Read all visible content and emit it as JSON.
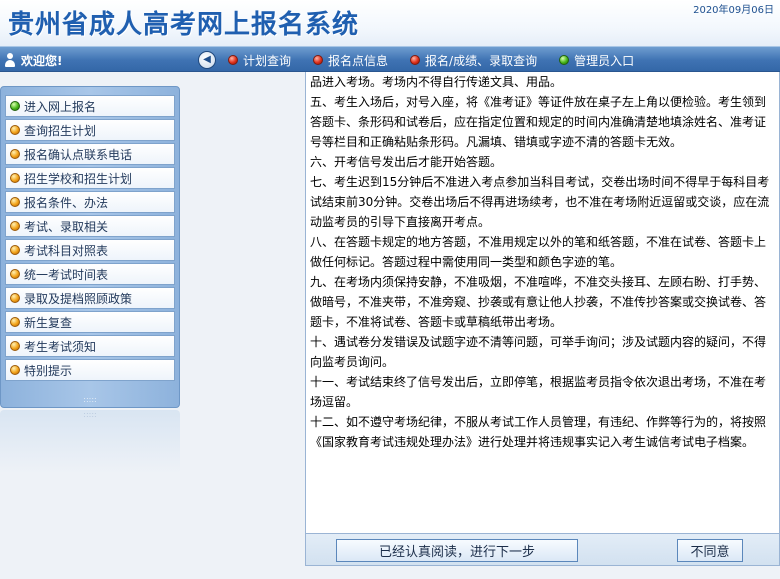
{
  "header": {
    "title": "贵州省成人高考网上报名系统",
    "date": "2020年09月06日"
  },
  "navbar": {
    "welcome": "欢迎您!",
    "items": [
      {
        "label": "计划查询"
      },
      {
        "label": "报名点信息"
      },
      {
        "label": "报名/成绩、录取查询"
      },
      {
        "label": "管理员入口"
      }
    ]
  },
  "sidebar": {
    "items": [
      {
        "label": "进入网上报名"
      },
      {
        "label": "查询招生计划"
      },
      {
        "label": "报名确认点联系电话"
      },
      {
        "label": "招生学校和招生计划"
      },
      {
        "label": "报名条件、办法"
      },
      {
        "label": "考试、录取相关"
      },
      {
        "label": "考试科目对照表"
      },
      {
        "label": "统一考试时间表"
      },
      {
        "label": "录取及提档照顾政策"
      },
      {
        "label": "新生复查"
      },
      {
        "label": "考生考试须知"
      },
      {
        "label": "特别提示"
      }
    ]
  },
  "content": {
    "paragraphs": [
      "品进入考场。考场内不得自行传递文具、用品。",
      "五、考生入场后，对号入座，将《准考证》等证件放在桌子左上角以便检验。考生领到答题卡、条形码和试卷后，应在指定位置和规定的时间内准确清楚地填涂姓名、准考证号等栏目和正确粘贴条形码。凡漏填、错填或字迹不清的答题卡无效。",
      "六、开考信号发出后才能开始答题。",
      "七、考生迟到15分钟后不准进入考点参加当科目考试，交卷出场时间不得早于每科目考试结束前30分钟。交卷出场后不得再进场续考，也不准在考场附近逗留或交谈，应在流动监考员的引导下直接离开考点。",
      "八、在答题卡规定的地方答题，不准用规定以外的笔和纸答题，不准在试卷、答题卡上做任何标记。答题过程中需使用同一类型和颜色字迹的笔。",
      "九、在考场内须保持安静，不准吸烟，不准喧哗，不准交头接耳、左顾右盼、打手势、做暗号，不准夹带，不准旁窥、抄袭或有意让他人抄袭，不准传抄答案或交换试卷、答题卡，不准将试卷、答题卡或草稿纸带出考场。",
      "十、遇试卷分发错误及试题字迹不清等问题，可举手询问；涉及试题内容的疑问，不得向监考员询问。",
      "十一、考试结束终了信号发出后，立即停笔，根据监考员指令依次退出考场，不准在考场逗留。",
      "十二、如不遵守考场纪律，不服从考试工作人员管理，有违纪、作弊等行为的，将按照《国家教育考试违规处理办法》进行处理并将违规事实记入考生诚信考试电子档案。"
    ]
  },
  "buttons": {
    "agree": "已经认真阅读，进行下一步",
    "disagree": "不同意"
  },
  "colors": {
    "title": "#1f5fb0",
    "navbar": "#3f73b3",
    "sidebar": "#a8c6e8"
  },
  "icons": {
    "welcome": "person-icon",
    "back": "back-arrow-icon",
    "nav_bullet": "red-dot-icon",
    "admin_bullet": "green-dot-icon",
    "menu_bullet": "orange-dot-icon",
    "menu_first_bullet": "green-dot-icon"
  }
}
